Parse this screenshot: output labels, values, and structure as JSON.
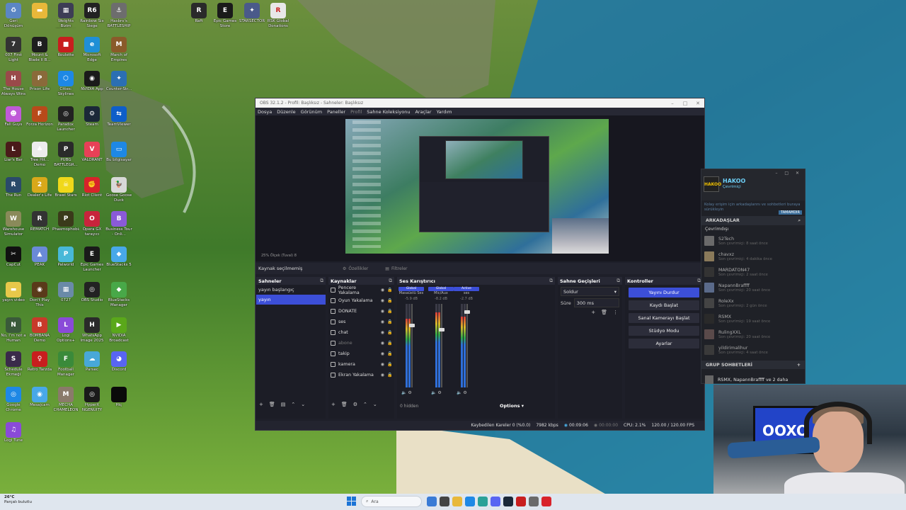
{
  "desktop": {
    "icons": [
      {
        "label": "Geri Dönüşüm",
        "color": "#5b86c4",
        "glyph": "♻",
        "icon": "recycle-bin-icon"
      },
      {
        "label": "",
        "color": "#e8b83a",
        "glyph": "▬",
        "icon": "folder-icon"
      },
      {
        "label": "Weights Bizim Wallpaper",
        "color": "#3d3d55",
        "glyph": "▦",
        "icon": "wallpaper-engine-icon"
      },
      {
        "label": "Rainbow Six Siege",
        "color": "#222222",
        "glyph": "R6",
        "icon": "r6-icon"
      },
      {
        "label": "Hasbro's BATTLESHIP",
        "color": "#6d6d6d",
        "glyph": "⚓",
        "icon": "battleship-icon"
      },
      {
        "label": "007 First Light",
        "color": "#333333",
        "glyph": "7",
        "icon": "007-icon"
      },
      {
        "label": "Mount & Blade II B...",
        "color": "#1e1e1e",
        "glyph": "B",
        "icon": "bannerlord-icon"
      },
      {
        "label": "Roulette",
        "color": "#c81e1e",
        "glyph": "■",
        "icon": "roulette-icon"
      },
      {
        "label": "Microsoft Edge",
        "color": "#1f8fd6",
        "glyph": "e",
        "icon": "edge-icon"
      },
      {
        "label": "March of Empires",
        "color": "#8a5a2a",
        "glyph": "M",
        "icon": "march-empires-icon"
      },
      {
        "label": "The House Always Wins",
        "color": "#9a4a4a",
        "glyph": "H",
        "icon": "house-wins-icon"
      },
      {
        "label": "Prison Life",
        "color": "#8a6a3a",
        "glyph": "P",
        "icon": "prison-icon"
      },
      {
        "label": "Cities: Skylines",
        "color": "#1e88e5",
        "glyph": "⬡",
        "icon": "cities-icon"
      },
      {
        "label": "NVIDIA App",
        "color": "#1a1a1a",
        "glyph": "◉",
        "icon": "nvidia-app-icon"
      },
      {
        "label": "Counter-Str...",
        "color": "#2b6fb3",
        "glyph": "✦",
        "icon": "cs-icon"
      },
      {
        "label": "Fall Guys",
        "color": "#c05ad8",
        "glyph": "☻",
        "icon": "fall-guys-icon"
      },
      {
        "label": "Forza Horizon",
        "color": "#b84a1a",
        "glyph": "F",
        "icon": "forza-icon"
      },
      {
        "label": "Paradox Launcher",
        "color": "#222222",
        "glyph": "◎",
        "icon": "paradox-icon"
      },
      {
        "label": "Steam",
        "color": "#1b2838",
        "glyph": "⚙",
        "icon": "steam-icon"
      },
      {
        "label": "TeamViewer",
        "color": "#0e5ec9",
        "glyph": "⇆",
        "icon": "teamviewer-icon"
      },
      {
        "label": "Liar's Bar",
        "color": "#4a1a1a",
        "glyph": "L",
        "icon": "liars-bar-icon"
      },
      {
        "label": "Tree Hit... Demo",
        "color": "#ececec",
        "glyph": "♣",
        "icon": "tree-icon"
      },
      {
        "label": "PUBG BATTLEGR...",
        "color": "#2a2a2a",
        "glyph": "P",
        "icon": "pubg-icon"
      },
      {
        "label": "VALORANT",
        "color": "#e84057",
        "glyph": "V",
        "icon": "valorant-icon"
      },
      {
        "label": "Bu bilgisayar",
        "color": "#1e88e5",
        "glyph": "▭",
        "icon": "this-pc-icon"
      },
      {
        "label": "The Run",
        "color": "#2a4a6a",
        "glyph": "R",
        "icon": "the-run-icon"
      },
      {
        "label": "Dealer's Life",
        "color": "#d8a81a",
        "glyph": "2",
        "icon": "dealers-life-icon"
      },
      {
        "label": "Brawl Stars",
        "color": "#f0d81a",
        "glyph": "☠",
        "icon": "brawl-stars-icon"
      },
      {
        "label": "Riot Client",
        "color": "#d8232a",
        "glyph": "✊",
        "icon": "riot-icon"
      },
      {
        "label": "Goose Goose Duck",
        "color": "#d8d8d8",
        "glyph": "🦆",
        "icon": "goose-icon"
      },
      {
        "label": "Warehouse Simulator",
        "color": "#8a8a5a",
        "glyph": "W",
        "icon": "warehouse-icon"
      },
      {
        "label": "REMATCH",
        "color": "#333333",
        "glyph": "R",
        "icon": "rematch-icon"
      },
      {
        "label": "Phasmophobia",
        "color": "#3a3a1a",
        "glyph": "P",
        "icon": "phasmophobia-icon"
      },
      {
        "label": "Opera GX tarayıcı",
        "color": "#c8243c",
        "glyph": "O",
        "icon": "opera-gx-icon"
      },
      {
        "label": "Business Tour - Onli...",
        "color": "#8a5ad8",
        "glyph": "B",
        "icon": "business-tour-icon"
      },
      {
        "label": "CapCut",
        "color": "#111111",
        "glyph": "✂",
        "icon": "capcut-icon"
      },
      {
        "label": "PEAK",
        "color": "#6a8ad8",
        "glyph": "▲",
        "icon": "peak-icon"
      },
      {
        "label": "Palworld",
        "color": "#48b8d8",
        "glyph": "P",
        "icon": "palworld-icon"
      },
      {
        "label": "Epic Games Launcher",
        "color": "#1a1a1a",
        "glyph": "E",
        "icon": "epic-icon"
      },
      {
        "label": "BlueStacks 5",
        "color": "#48a8e8",
        "glyph": "◆",
        "icon": "bluestacks-icon"
      },
      {
        "label": "yayın video",
        "color": "#e8c84a",
        "glyph": "▬",
        "icon": "folder-yayin-icon"
      },
      {
        "label": "Don't Play This",
        "color": "#5a3a1a",
        "glyph": "◉",
        "icon": "dont-play-icon"
      },
      {
        "label": "0727",
        "color": "#6a8aa8",
        "glyph": "▦",
        "icon": "image-0727-icon"
      },
      {
        "label": "OBS Studio",
        "color": "#222222",
        "glyph": "◎",
        "icon": "obs-icon"
      },
      {
        "label": "BlueStacks Manager",
        "color": "#48a848",
        "glyph": "◆",
        "icon": "bluestacks-manager-icon"
      },
      {
        "label": "No, I'm not a Human",
        "color": "#3a5a3a",
        "glyph": "N",
        "icon": "not-human-icon"
      },
      {
        "label": "BOMBANA Demo",
        "color": "#c83a2a",
        "glyph": "B",
        "icon": "bombana-icon"
      },
      {
        "label": "Logi Options+",
        "color": "#8a4ad8",
        "glyph": "L",
        "icon": "logi-options-icon"
      },
      {
        "label": "WhatsApp Image 2025",
        "color": "#2a2a2a",
        "glyph": "H",
        "icon": "whatsapp-image-icon"
      },
      {
        "label": "NVIDIA Broadcast",
        "color": "#5aa81a",
        "glyph": "▶",
        "icon": "nvidia-broadcast-icon"
      },
      {
        "label": "Schedule Ekmeği",
        "color": "#3a2a4a",
        "glyph": "S",
        "icon": "schedule-icon"
      },
      {
        "label": "Retro Tarzda",
        "color": "#c81e1e",
        "glyph": "♀",
        "icon": "retro-icon"
      },
      {
        "label": "Football Manager",
        "color": "#3a8a3a",
        "glyph": "F",
        "icon": "football-icon"
      },
      {
        "label": "Parsec",
        "color": "#48a8d8",
        "glyph": "☁",
        "icon": "parsec-icon"
      },
      {
        "label": "Discord",
        "color": "#5865f2",
        "glyph": "◕",
        "icon": "discord-icon"
      },
      {
        "label": "Google Chrome",
        "color": "#1e88e5",
        "glyph": "◎",
        "icon": "chrome-icon"
      },
      {
        "label": "Mesajcam",
        "color": "#48a8e8",
        "glyph": "◉",
        "icon": "mesajcam-icon"
      },
      {
        "label": "MECHA CHAMELEON",
        "color": "#8a7a6a",
        "glyph": "M",
        "icon": "mecha-icon"
      },
      {
        "label": "HyperX NGENUITY",
        "color": "#1a1a1a",
        "glyph": "◎",
        "icon": "hyperx-icon"
      },
      {
        "label": "Hiç",
        "color": "#0a0a0a",
        "glyph": "",
        "icon": "black-file-icon"
      },
      {
        "label": "Logi Tune",
        "color": "#8a4ad8",
        "glyph": "♫",
        "icon": "logi-tune-icon"
      }
    ],
    "top_icons": [
      {
        "label": "Raft",
        "color": "#2a2a2a",
        "glyph": "R",
        "icon": "raft-icon"
      },
      {
        "label": "Epic Games Store",
        "color": "#1a1a1a",
        "glyph": "E",
        "icon": "epic-store-icon"
      },
      {
        "label": "STARSECTOR",
        "color": "#4a5a8a",
        "glyph": "✦",
        "icon": "starsector-icon"
      },
      {
        "label": "RSK Global Donations",
        "color": "#e8e8e8",
        "glyph": "R",
        "icon": "rsk-icon"
      }
    ]
  },
  "obs": {
    "title": "OBS 32.1.2 - Profil: Başlıksız - Sahneler: Başlıksız",
    "menu": [
      "Dosya",
      "Düzenle",
      "Görünüm",
      "Paneller",
      "Profil",
      "Sahne Koleksiyonu",
      "Araçlar",
      "Yardım"
    ],
    "preview_zoom": "25%   Ölçek (Tuval) 8",
    "source_status": "Kaynak seçilmemiş",
    "properties_btn": "Özellikler",
    "filters_btn": "Filtreler",
    "docks": {
      "scenes_title": "Sahneler",
      "sources_title": "Kaynaklar",
      "mixer_title": "Ses Karıştırıcı",
      "transitions_title": "Sahne Geçişleri",
      "controls_title": "Kontroller"
    },
    "scenes": [
      "yayın başlangıç",
      "yayın"
    ],
    "sources": [
      {
        "name": "Pencere Yakalama",
        "dim": false
      },
      {
        "name": "Oyun Yakalama",
        "dim": false
      },
      {
        "name": "DONATE",
        "dim": false
      },
      {
        "name": "ses",
        "dim": false
      },
      {
        "name": "chat",
        "dim": false
      },
      {
        "name": "abone",
        "dim": true
      },
      {
        "name": "takip",
        "dim": false
      },
      {
        "name": "kamera",
        "dim": false
      },
      {
        "name": "Ekran Yakalama",
        "dim": false
      }
    ],
    "mixer": {
      "channels": [
        {
          "badge": "Global",
          "name": "Masaüstü Ses",
          "db": "-5.9 dB",
          "level": 0.82,
          "fader": 0.75
        },
        {
          "badge": "Global",
          "name": "Mic/Aux",
          "db": "-8.2 dB",
          "level": 0.9,
          "fader": 0.7
        },
        {
          "badge": "Active",
          "name": "ses",
          "db": "-2.7 dB",
          "level": 0.85,
          "fader": 0.92
        }
      ],
      "hidden": "0 hidden",
      "options": "Options"
    },
    "transitions": {
      "type": "Soldur",
      "duration_label": "Süre",
      "duration_value": "300 ms"
    },
    "controls": [
      "Yayını Durdur",
      "Kaydı Başlat",
      "Sanal Kamerayı Başlat",
      "Stüdyo Modu",
      "Ayarlar"
    ],
    "statusbar": {
      "dropped": "Kaybedilen Kareler 0 (%0.0)",
      "bitrate": "7982 kbps",
      "stream_time": "00:09:06",
      "rec_time": "00:00:00",
      "cpu": "CPU: 2.1%",
      "fps": "120.00 / 120.00 FPS"
    }
  },
  "steam": {
    "name": "HAKOO",
    "avatar_text": "HAKOO",
    "status": "Çevrimiçi",
    "privacy": "Kolay erişim için arkadaşlarını ve sohbetleri buraya sürükleyin",
    "privacy_btn": "TAMAMDIR",
    "friends_header": "ARKADAŞLAR",
    "offline_header": "Çevrimdışı",
    "friends": [
      {
        "name": "S2Tech",
        "status": "Son çevrimiçi: 8 saat önce"
      },
      {
        "name": "chavxz",
        "status": "Son çevrimiçi: 4 dakika önce"
      },
      {
        "name": "MARDATON47",
        "status": "Son çevrimiçi: 2 saat önce"
      },
      {
        "name": "NapannBraffff",
        "status": "Son çevrimiçi: 20 saat önce"
      },
      {
        "name": "RoleXx",
        "status": "Son çevrimiçi: 2 gün önce"
      },
      {
        "name": "RSMX",
        "status": "Son çevrimiçi: 19 saat önce"
      },
      {
        "name": "RulingXXL",
        "status": "Son çevrimiçi: 20 saat önce"
      },
      {
        "name": "yildirimalihur",
        "status": "Son çevrimiçi: 4 saat önce"
      }
    ],
    "group_header": "GRUP SOHBETLERİ",
    "group_item": "RSMX, NapannBraffff ve 2 daha"
  },
  "webcam": {
    "screen_text": "OOXO"
  },
  "taskbar": {
    "weather_temp": "26°C",
    "weather_text": "Parçalı bulutlu",
    "search_placeholder": "Ara",
    "colors": [
      "#3a7bd5",
      "#444444",
      "#e8b83a",
      "#1e88e5",
      "#2aa198",
      "#5865f2",
      "#1b2838",
      "#c81e1e",
      "#6a6a6a",
      "#d8232a"
    ]
  }
}
